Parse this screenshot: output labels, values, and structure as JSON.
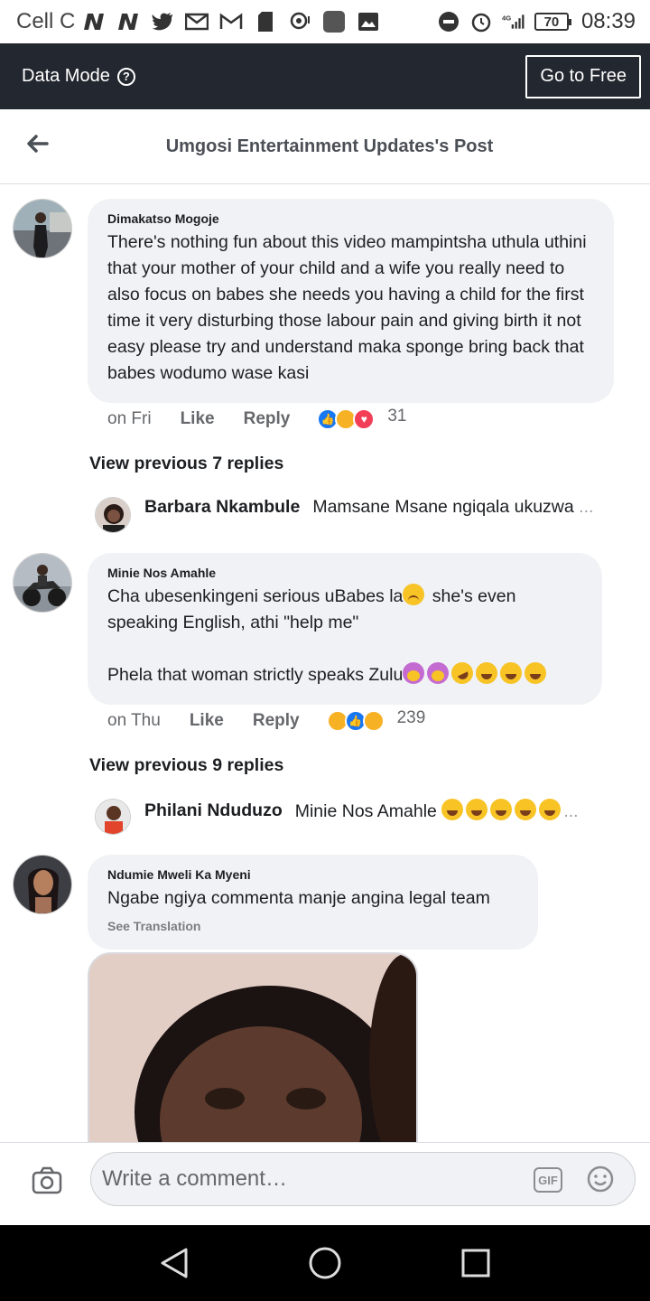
{
  "status_bar": {
    "carrier": "Cell C",
    "battery": "70",
    "time": "08:39",
    "network": "4G"
  },
  "data_mode": {
    "label": "Data Mode",
    "help_icon": "question-circle-icon",
    "button": "Go to Free"
  },
  "header": {
    "title": "Umgosi Entertainment Updates's Post"
  },
  "comments": [
    {
      "author": "Dimakatso Mogoje",
      "text": "There's nothing fun about this video mampintsha uthula uthini that your mother of your child and a wife you really need to also focus on babes she needs you having a child for the first time it very disturbing those labour  pain and giving birth it not easy please try and understand maka sponge bring back that babes wodumo wase kasi",
      "time": "on Fri",
      "like": "Like",
      "reply": "Reply",
      "reaction_count": "31",
      "view_previous": "View previous 7 replies",
      "latest_reply": {
        "author": "Barbara Nkambule",
        "text": "Mamsane Msane ngiqala ukuzwa",
        "ellipsis": "..."
      }
    },
    {
      "author": "Minie Nos Amahle",
      "text_line1": "Cha ubesenkingeni serious uBabes la",
      "text_line1b": " she's even",
      "text_line2": "speaking English, athi \"help me\"",
      "text_line3": "Phela that woman strictly speaks Zulu",
      "time": "on Thu",
      "like": "Like",
      "reply": "Reply",
      "reaction_count": "239",
      "view_previous": "View previous 9 replies",
      "latest_reply": {
        "author": "Philani Nduduzo",
        "text": "Minie Nos Amahle",
        "ellipsis": "..."
      }
    },
    {
      "author": "Ndumie Mweli Ka Myeni",
      "text": "Ngabe ngiya commenta manje angina legal team",
      "see_translation": "See Translation"
    }
  ],
  "composer": {
    "placeholder": "Write a comment…",
    "gif": "GIF"
  },
  "colors": {
    "data_mode_bg": "#23272f",
    "bubble_bg": "#f0f2f5",
    "like_blue": "#1877f2",
    "love_red": "#f33e58",
    "haha_yellow": "#f7b125"
  }
}
